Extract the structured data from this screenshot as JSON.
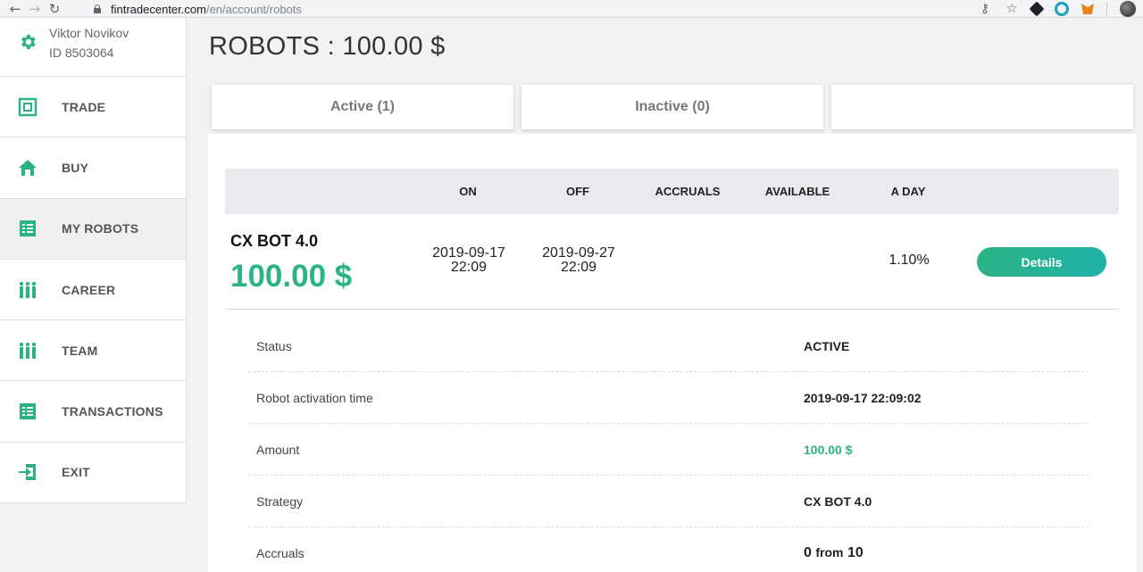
{
  "browser": {
    "url_host": "fintradecenter.com",
    "url_path": "/en/account/robots"
  },
  "profile": {
    "name": "Viktor Novikov",
    "id": "ID 8503064"
  },
  "sidebar": {
    "items": [
      {
        "label": "TRADE",
        "icon": "trade-icon"
      },
      {
        "label": "BUY",
        "icon": "home-icon"
      },
      {
        "label": "MY ROBOTS",
        "icon": "list-icon"
      },
      {
        "label": "CAREER",
        "icon": "people-icon"
      },
      {
        "label": "TEAM",
        "icon": "people-icon"
      },
      {
        "label": "TRANSACTIONS",
        "icon": "list-icon"
      },
      {
        "label": "EXIT",
        "icon": "exit-icon"
      }
    ]
  },
  "page": {
    "title": "ROBOTS : 100.00 $"
  },
  "tabs": [
    {
      "label": "Active (1)"
    },
    {
      "label": "Inactive (0)"
    },
    {
      "label": ""
    }
  ],
  "table": {
    "headers": [
      "ON",
      "OFF",
      "ACCRUALS",
      "AVAILABLE",
      "A DAY"
    ],
    "robot": {
      "name": "CX BOT 4.0",
      "amount": "100.00 $",
      "on_date": "2019-09-17",
      "on_time": "22:09",
      "off_date": "2019-09-27",
      "off_time": "22:09",
      "a_day": "1.10%",
      "details_label": "Details"
    }
  },
  "details": {
    "status_key": "Status",
    "status_value": "ACTIVE",
    "activation_key": "Robot activation time",
    "activation_value": "2019-09-17 22:09:02",
    "amount_key": "Amount",
    "amount_value": "100.00 $",
    "strategy_key": "Strategy",
    "strategy_value": "CX BOT 4.0",
    "accruals_key": "Accruals",
    "accruals_value_count": "0",
    "accruals_value_from": "from",
    "accruals_value_total": "10"
  },
  "colors": {
    "accent": "#2bb383",
    "sidebar_icon": "#2bb383"
  }
}
